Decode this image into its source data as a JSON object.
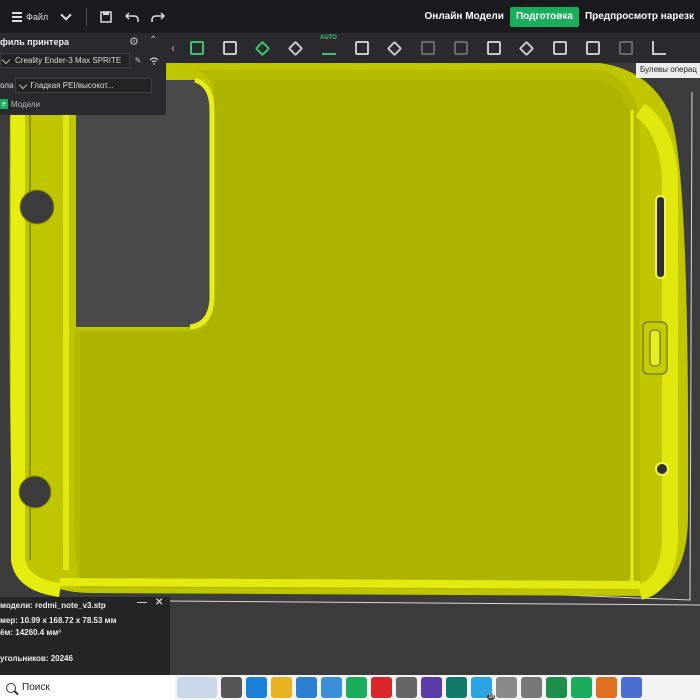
{
  "topbar": {
    "file_label": "Файл",
    "tabs": [
      {
        "label": "Онлайн Модели",
        "active": false
      },
      {
        "label": "Подготовка",
        "active": true
      },
      {
        "label": "Предпросмотр нарезк",
        "active": false
      }
    ],
    "accent_color": "#1aae5c"
  },
  "toolbar": {
    "collapse_glyph": "‹",
    "auto_label": "AUTO",
    "tools": [
      "add-cube-icon",
      "add-plate-icon",
      "orient-icon",
      "arrange-icon",
      "auto-arrange-icon",
      "split-plate-icon",
      "erase-icon",
      "grid-icon",
      "grid2-icon",
      "scale-icon",
      "cube-icon",
      "hollow-icon",
      "cut-icon",
      "boolean-icon",
      "measure-icon"
    ],
    "tooltip": "Булевы операц"
  },
  "printer_panel": {
    "title": "филь принтера",
    "printer_name": "Creality Ender-3 Max SPRITE",
    "plate_label": "ола",
    "plate_value": "Гладкая PEI/высокот...",
    "models_label": "Модели",
    "models_badge": "е"
  },
  "viewport": {
    "model_color": "#d8e000",
    "background": "#3c3c3c"
  },
  "model_info": {
    "name_line": "модели: redmi_note_v3.stp",
    "size_line": "мер: 10.99 x 168.72 x 78.53 мм",
    "volume_line": "ём: 14260.4 мм³",
    "triangles_line": "угольников: 20246",
    "minimize_glyph": "—",
    "close_glyph": "✕"
  },
  "taskbar": {
    "search_label": "Поиск",
    "badge_count": "18"
  }
}
